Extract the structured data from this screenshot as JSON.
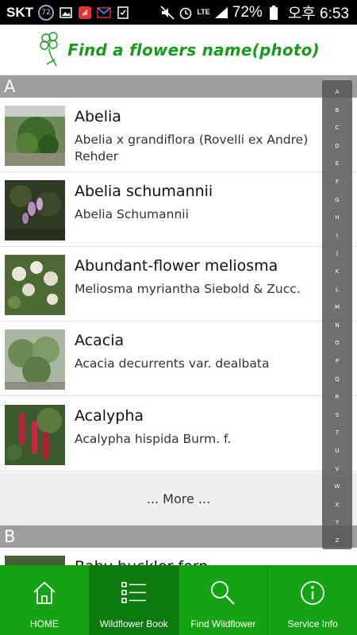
{
  "status_bar": {
    "carrier": "SKT",
    "badge": "72",
    "network": "LTE",
    "battery_percent": "72%",
    "time": "오후 6:53"
  },
  "app": {
    "title": "Find a flowers name(photo)",
    "brand_color": "#1a9a1a"
  },
  "sections": [
    {
      "letter": "A"
    },
    {
      "letter": "B"
    }
  ],
  "list": [
    {
      "name": "Abelia",
      "scientific": "Abelia x grandiflora (Rovelli ex Andre) Rehder"
    },
    {
      "name": "Abelia schumannii",
      "scientific": "Abelia Schumannii"
    },
    {
      "name": "Abundant-flower meliosma",
      "scientific": "Meliosma myriantha Siebold & Zucc."
    },
    {
      "name": "Acacia",
      "scientific": "Acacia decurrents var. dealbata"
    },
    {
      "name": "Acalypha",
      "scientific": "Acalypha hispida Burm. f."
    },
    {
      "name": "Baby buckler fern",
      "scientific": ""
    }
  ],
  "more_label": "... More ...",
  "alphabet": [
    "A",
    "B",
    "C",
    "D",
    "E",
    "F",
    "G",
    "H",
    "I",
    "J",
    "K",
    "L",
    "M",
    "N",
    "O",
    "P",
    "Q",
    "R",
    "S",
    "T",
    "U",
    "V",
    "W",
    "X",
    "Y",
    "Z"
  ],
  "bottom_nav": [
    {
      "label": "HOME",
      "icon": "home-icon"
    },
    {
      "label": "Wildflower Book",
      "icon": "list-icon"
    },
    {
      "label": "Find Wildflower",
      "icon": "search-icon"
    },
    {
      "label": "Service Info",
      "icon": "info-icon"
    }
  ],
  "colors": {
    "nav_green": "#13a313",
    "nav_active": "#0c7a0c",
    "section_gray": "#9e9e9e"
  }
}
